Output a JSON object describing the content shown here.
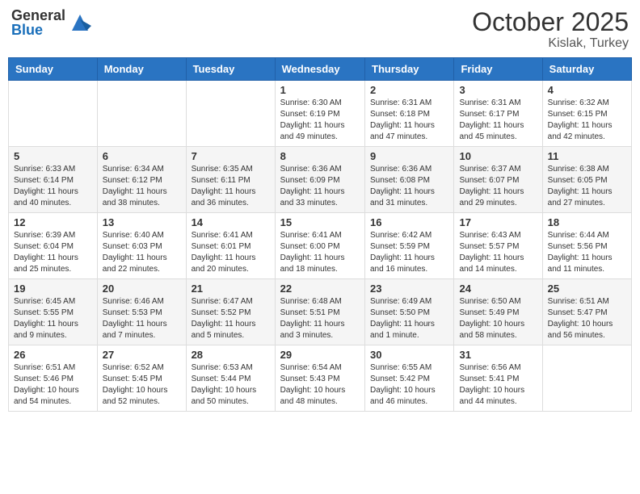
{
  "header": {
    "logo_general": "General",
    "logo_blue": "Blue",
    "month_year": "October 2025",
    "location": "Kislak, Turkey"
  },
  "weekdays": [
    "Sunday",
    "Monday",
    "Tuesday",
    "Wednesday",
    "Thursday",
    "Friday",
    "Saturday"
  ],
  "weeks": [
    [
      {
        "day": "",
        "info": ""
      },
      {
        "day": "",
        "info": ""
      },
      {
        "day": "",
        "info": ""
      },
      {
        "day": "1",
        "info": "Sunrise: 6:30 AM\nSunset: 6:19 PM\nDaylight: 11 hours\nand 49 minutes."
      },
      {
        "day": "2",
        "info": "Sunrise: 6:31 AM\nSunset: 6:18 PM\nDaylight: 11 hours\nand 47 minutes."
      },
      {
        "day": "3",
        "info": "Sunrise: 6:31 AM\nSunset: 6:17 PM\nDaylight: 11 hours\nand 45 minutes."
      },
      {
        "day": "4",
        "info": "Sunrise: 6:32 AM\nSunset: 6:15 PM\nDaylight: 11 hours\nand 42 minutes."
      }
    ],
    [
      {
        "day": "5",
        "info": "Sunrise: 6:33 AM\nSunset: 6:14 PM\nDaylight: 11 hours\nand 40 minutes."
      },
      {
        "day": "6",
        "info": "Sunrise: 6:34 AM\nSunset: 6:12 PM\nDaylight: 11 hours\nand 38 minutes."
      },
      {
        "day": "7",
        "info": "Sunrise: 6:35 AM\nSunset: 6:11 PM\nDaylight: 11 hours\nand 36 minutes."
      },
      {
        "day": "8",
        "info": "Sunrise: 6:36 AM\nSunset: 6:09 PM\nDaylight: 11 hours\nand 33 minutes."
      },
      {
        "day": "9",
        "info": "Sunrise: 6:36 AM\nSunset: 6:08 PM\nDaylight: 11 hours\nand 31 minutes."
      },
      {
        "day": "10",
        "info": "Sunrise: 6:37 AM\nSunset: 6:07 PM\nDaylight: 11 hours\nand 29 minutes."
      },
      {
        "day": "11",
        "info": "Sunrise: 6:38 AM\nSunset: 6:05 PM\nDaylight: 11 hours\nand 27 minutes."
      }
    ],
    [
      {
        "day": "12",
        "info": "Sunrise: 6:39 AM\nSunset: 6:04 PM\nDaylight: 11 hours\nand 25 minutes."
      },
      {
        "day": "13",
        "info": "Sunrise: 6:40 AM\nSunset: 6:03 PM\nDaylight: 11 hours\nand 22 minutes."
      },
      {
        "day": "14",
        "info": "Sunrise: 6:41 AM\nSunset: 6:01 PM\nDaylight: 11 hours\nand 20 minutes."
      },
      {
        "day": "15",
        "info": "Sunrise: 6:41 AM\nSunset: 6:00 PM\nDaylight: 11 hours\nand 18 minutes."
      },
      {
        "day": "16",
        "info": "Sunrise: 6:42 AM\nSunset: 5:59 PM\nDaylight: 11 hours\nand 16 minutes."
      },
      {
        "day": "17",
        "info": "Sunrise: 6:43 AM\nSunset: 5:57 PM\nDaylight: 11 hours\nand 14 minutes."
      },
      {
        "day": "18",
        "info": "Sunrise: 6:44 AM\nSunset: 5:56 PM\nDaylight: 11 hours\nand 11 minutes."
      }
    ],
    [
      {
        "day": "19",
        "info": "Sunrise: 6:45 AM\nSunset: 5:55 PM\nDaylight: 11 hours\nand 9 minutes."
      },
      {
        "day": "20",
        "info": "Sunrise: 6:46 AM\nSunset: 5:53 PM\nDaylight: 11 hours\nand 7 minutes."
      },
      {
        "day": "21",
        "info": "Sunrise: 6:47 AM\nSunset: 5:52 PM\nDaylight: 11 hours\nand 5 minutes."
      },
      {
        "day": "22",
        "info": "Sunrise: 6:48 AM\nSunset: 5:51 PM\nDaylight: 11 hours\nand 3 minutes."
      },
      {
        "day": "23",
        "info": "Sunrise: 6:49 AM\nSunset: 5:50 PM\nDaylight: 11 hours\nand 1 minute."
      },
      {
        "day": "24",
        "info": "Sunrise: 6:50 AM\nSunset: 5:49 PM\nDaylight: 10 hours\nand 58 minutes."
      },
      {
        "day": "25",
        "info": "Sunrise: 6:51 AM\nSunset: 5:47 PM\nDaylight: 10 hours\nand 56 minutes."
      }
    ],
    [
      {
        "day": "26",
        "info": "Sunrise: 6:51 AM\nSunset: 5:46 PM\nDaylight: 10 hours\nand 54 minutes."
      },
      {
        "day": "27",
        "info": "Sunrise: 6:52 AM\nSunset: 5:45 PM\nDaylight: 10 hours\nand 52 minutes."
      },
      {
        "day": "28",
        "info": "Sunrise: 6:53 AM\nSunset: 5:44 PM\nDaylight: 10 hours\nand 50 minutes."
      },
      {
        "day": "29",
        "info": "Sunrise: 6:54 AM\nSunset: 5:43 PM\nDaylight: 10 hours\nand 48 minutes."
      },
      {
        "day": "30",
        "info": "Sunrise: 6:55 AM\nSunset: 5:42 PM\nDaylight: 10 hours\nand 46 minutes."
      },
      {
        "day": "31",
        "info": "Sunrise: 6:56 AM\nSunset: 5:41 PM\nDaylight: 10 hours\nand 44 minutes."
      },
      {
        "day": "",
        "info": ""
      }
    ]
  ]
}
